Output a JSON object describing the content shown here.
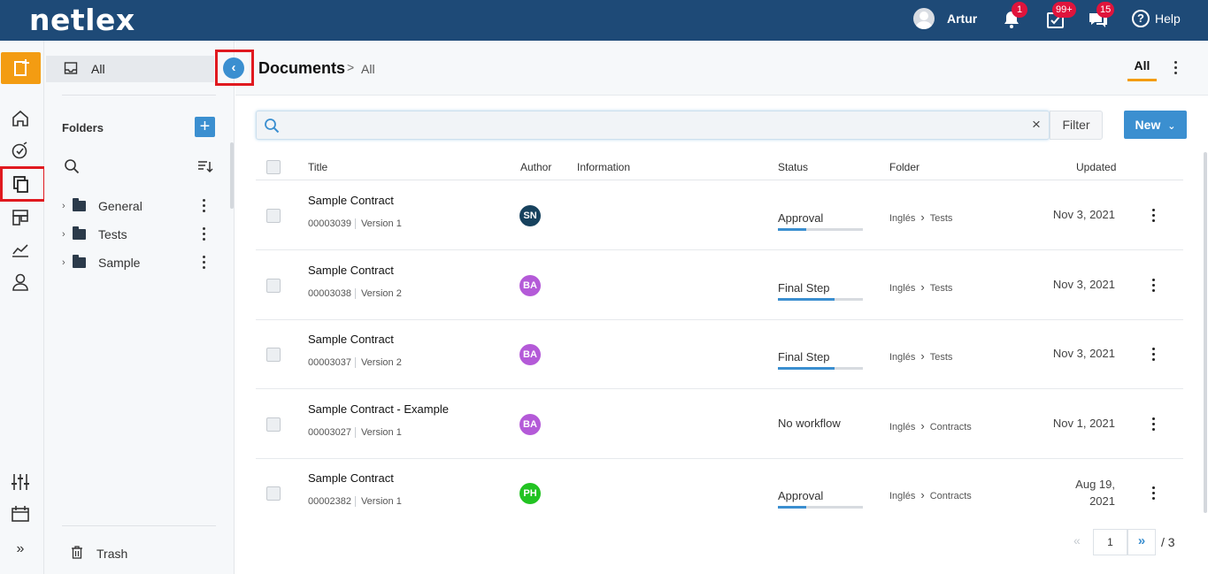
{
  "brand": {
    "logo": "netlex"
  },
  "topbar": {
    "user_name": "Artur",
    "notifications_badge": "1",
    "tasks_badge": "99+",
    "messages_badge": "15",
    "help_label": "Help"
  },
  "rail": {
    "icons": [
      "new-document-icon",
      "home-icon",
      "compass-icon",
      "documents-icon",
      "board-icon",
      "chart-icon",
      "user-icon",
      "settings-sliders-icon",
      "calendar-icon",
      "expand-icon"
    ],
    "expand_glyph": "»"
  },
  "folders_panel": {
    "all_label": "All",
    "title": "Folders",
    "add_glyph": "+",
    "items": [
      {
        "label": "General"
      },
      {
        "label": "Tests"
      },
      {
        "label": "Sample"
      }
    ],
    "trash_label": "Trash"
  },
  "main": {
    "title": "Documents",
    "breadcrumb_sep": ">",
    "breadcrumb": "All",
    "tab_all": "All",
    "search": {
      "value": "",
      "placeholder": "",
      "clear_glyph": "×"
    },
    "filter_label": "Filter",
    "new_label": "New",
    "columns": {
      "title": "Title",
      "author": "Author",
      "information": "Information",
      "status": "Status",
      "folder": "Folder",
      "updated": "Updated"
    },
    "rows": [
      {
        "title": "Sample Contract",
        "number": "00003039",
        "version": "Version 1",
        "author": "SN",
        "author_color": "#17425e",
        "status": "Approval",
        "progress": 0.33,
        "folder_root": "Inglés",
        "folder_leaf": "Tests",
        "updated": "Nov 3, 2021"
      },
      {
        "title": "Sample Contract",
        "number": "00003038",
        "version": "Version 2",
        "author": "BA",
        "author_color": "#b45ad8",
        "status": "Final Step",
        "progress": 0.67,
        "folder_root": "Inglés",
        "folder_leaf": "Tests",
        "updated": "Nov 3, 2021"
      },
      {
        "title": "Sample Contract",
        "number": "00003037",
        "version": "Version 2",
        "author": "BA",
        "author_color": "#b45ad8",
        "status": "Final Step",
        "progress": 0.67,
        "folder_root": "Inglés",
        "folder_leaf": "Tests",
        "updated": "Nov 3, 2021"
      },
      {
        "title": "Sample Contract - Example",
        "number": "00003027",
        "version": "Version 1",
        "author": "BA",
        "author_color": "#b45ad8",
        "status": "No workflow",
        "progress": null,
        "folder_root": "Inglés",
        "folder_leaf": "Contracts",
        "updated": "Nov 1, 2021"
      },
      {
        "title": "Sample Contract",
        "number": "00002382",
        "version": "Version 1",
        "author": "PH",
        "author_color": "#22c322",
        "status": "Approval",
        "progress": 0.33,
        "folder_root": "Inglés",
        "folder_leaf": "Contracts",
        "updated": "Aug 19, 2021"
      }
    ],
    "pagination": {
      "prev_glyph": "«",
      "current": "1",
      "next_glyph": "»",
      "total": "/ 3"
    }
  },
  "colors": {
    "topbar": "#1e4a77",
    "accent": "#3b8fd0",
    "new_button": "#f39c12",
    "badge": "#e0143c",
    "highlight": "#e0191f"
  }
}
